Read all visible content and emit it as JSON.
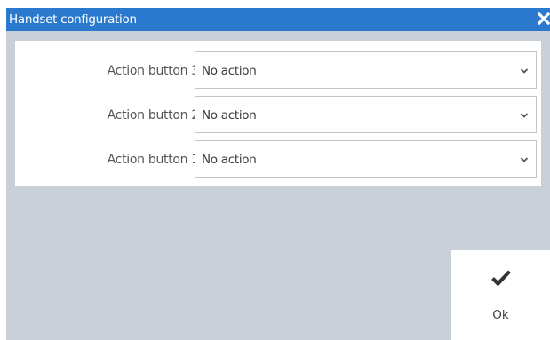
{
  "dialog": {
    "title": "Handset configuration",
    "close_icon": "close-icon"
  },
  "rows": [
    {
      "label": "Action button 3",
      "selected": "No action"
    },
    {
      "label": "Action button 2",
      "selected": "No action"
    },
    {
      "label": "Action button 1",
      "selected": "No action"
    }
  ],
  "ok_button": {
    "label": "Ok",
    "icon": "checkmark-icon"
  },
  "colors": {
    "titlebar": "#2a79cf",
    "dialog_background": "#c8cfd6",
    "panel": "#ffffff"
  }
}
